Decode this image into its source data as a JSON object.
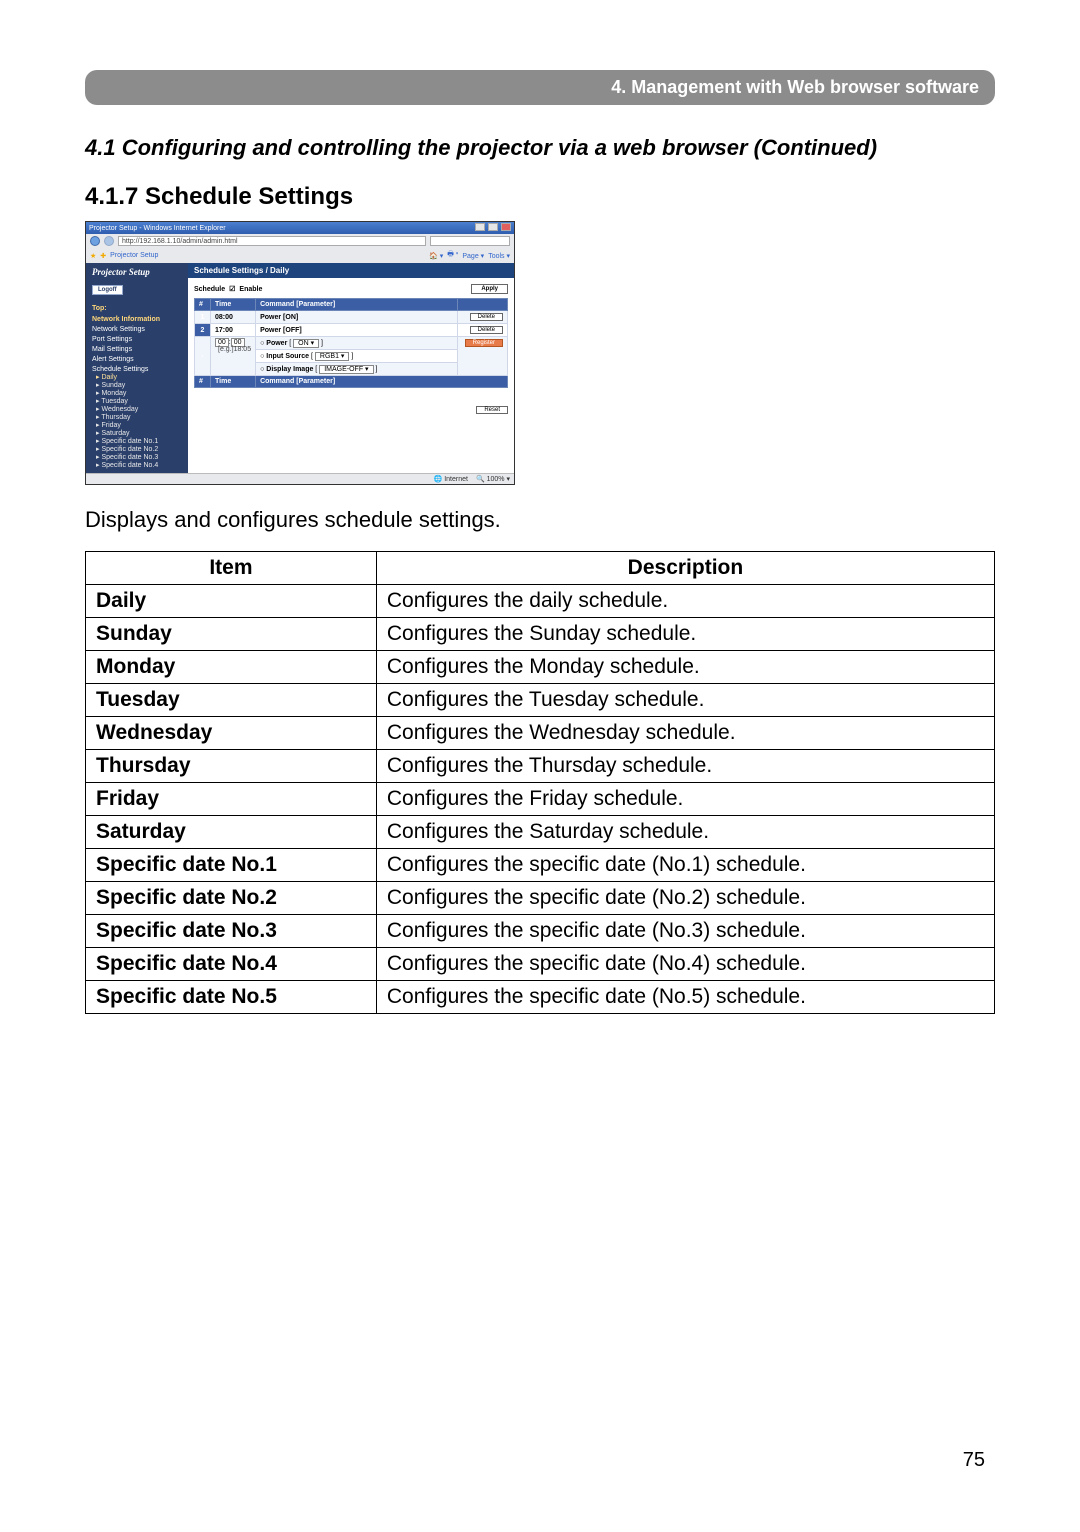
{
  "chapter_bar": "4. Management with Web browser software",
  "section_title": "4.1 Configuring and controlling the projector via a web browser (Continued)",
  "subsection_title": "4.1.7 Schedule Settings",
  "caption": "Displays and configures schedule settings.",
  "page_number": "75",
  "mini": {
    "window_title": "Projector Setup - Windows Internet Explorer",
    "url": "http://192.168.1.10/admin/admin.html",
    "tab_label": "Projector Setup",
    "brand": "Projector Setup",
    "logoff": "Logoff",
    "top_label": "Top:",
    "net_info": "Network Information",
    "nav": {
      "net_settings": "Network Settings",
      "port_settings": "Port Settings",
      "mail_settings": "Mail Settings",
      "alert_settings": "Alert Settings",
      "schedule_settings": "Schedule Settings"
    },
    "sched_items": {
      "daily": "Daily",
      "sunday": "Sunday",
      "monday": "Monday",
      "tuesday": "Tuesday",
      "wednesday": "Wednesday",
      "thursday": "Thursday",
      "friday": "Friday",
      "saturday": "Saturday",
      "sd1": "Specific date No.1",
      "sd2": "Specific date No.2",
      "sd3": "Specific date No.3",
      "sd4": "Specific date No.4"
    },
    "panel_title": "Schedule Settings / Daily",
    "schedule_label": "Schedule",
    "enable_label": "Enable",
    "apply": "Apply",
    "th_num": "#",
    "th_time": "Time",
    "th_cmd": "Command [Parameter]",
    "row1": {
      "n": "1",
      "time": "08:00",
      "cmd": "Power [ON]",
      "btn": "Delete"
    },
    "row2": {
      "n": "2",
      "time": "17:00",
      "cmd": "Power [OFF]",
      "btn": "Delete"
    },
    "new": {
      "time_row_a": "00",
      "time_row_b": "00",
      "eg": "[e.g.]18:05",
      "power": "Power",
      "power_opt": "ON",
      "inputsrc": "Input Source",
      "inputsrc_opt": "RGB1",
      "dispimg": "Display Image",
      "dispimg_opt": "IMAGE-OFF",
      "register": "Register"
    },
    "reset": "Reset",
    "status_internet": "Internet",
    "status_zoom": "100%"
  },
  "table": {
    "head_item": "Item",
    "head_desc": "Description",
    "rows": [
      {
        "item": "Daily",
        "desc": "Configures the daily schedule."
      },
      {
        "item": "Sunday",
        "desc": "Configures the Sunday schedule."
      },
      {
        "item": "Monday",
        "desc": "Configures the Monday schedule."
      },
      {
        "item": "Tuesday",
        "desc": "Configures the Tuesday schedule."
      },
      {
        "item": "Wednesday",
        "desc": "Configures the Wednesday schedule."
      },
      {
        "item": "Thursday",
        "desc": "Configures the Thursday schedule."
      },
      {
        "item": "Friday",
        "desc": "Configures the Friday schedule."
      },
      {
        "item": "Saturday",
        "desc": "Configures the Saturday schedule."
      },
      {
        "item": "Specific date No.1",
        "desc": "Configures the specific date (No.1) schedule."
      },
      {
        "item": "Specific date No.2",
        "desc": "Configures the specific date (No.2) schedule."
      },
      {
        "item": "Specific date No.3",
        "desc": "Configures the specific date (No.3) schedule."
      },
      {
        "item": "Specific date No.4",
        "desc": "Configures the specific date (No.4) schedule."
      },
      {
        "item": "Specific date No.5",
        "desc": "Configures the specific date (No.5) schedule."
      }
    ]
  }
}
